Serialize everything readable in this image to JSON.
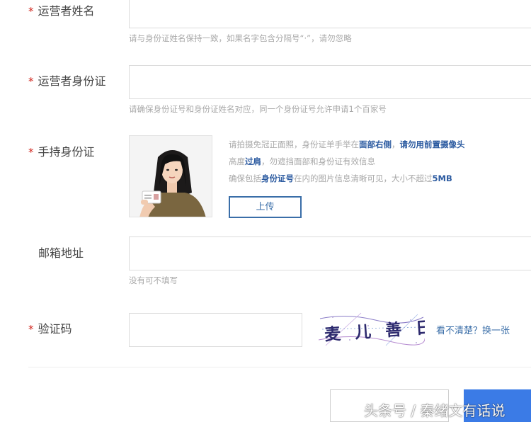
{
  "fields": {
    "name": {
      "label": "运营者姓名",
      "value": "",
      "hint": "请与身份证姓名保持一致，如果名字包含分隔号“·”，请勿忽略"
    },
    "id_card": {
      "label": "运营者身份证",
      "value": "",
      "hint": "请确保身份证号和身份证姓名对应，同一个身份证号允许申请1个百家号"
    },
    "hand_id": {
      "label": "手持身份证",
      "tips": [
        {
          "parts": [
            "请拍摄免冠正面照，身份证单手举在",
            "面部右侧",
            "，",
            "请勿用前置摄像头"
          ]
        },
        {
          "parts": [
            "高度",
            "过肩",
            "，勿遮挡面部和身份证有效信息"
          ]
        },
        {
          "parts": [
            "确保包括",
            "身份证号",
            "在内的图片信息清晰可见，大小不超过",
            "5MB"
          ]
        }
      ],
      "upload_label": "上传"
    },
    "email": {
      "label": "邮箱地址",
      "value": "",
      "hint": "没有可不填写"
    },
    "captcha": {
      "label": "验证码",
      "value": "",
      "captcha_text": "麦 儿 善 日",
      "refresh_label": "看不清楚？换一张"
    }
  },
  "required_mark": "*",
  "watermark": "头条号 / 秦绪文有话说",
  "colors": {
    "required": "#d0231b",
    "link": "#3a6ea8",
    "primary": "#3b7be6",
    "border": "#dcdcdc",
    "hint": "#a8a8a8"
  }
}
